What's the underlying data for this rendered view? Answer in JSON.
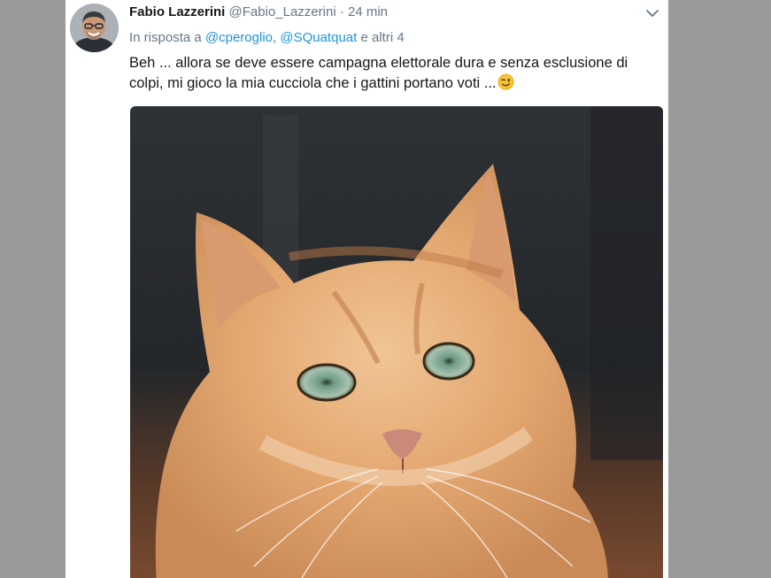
{
  "tweet": {
    "author_name": "Fabio Lazzerini",
    "author_handle": "@Fabio_Lazzerini",
    "separator": "·",
    "time": "24 min",
    "reply_prefix": "In risposta a",
    "reply_mention_1": "@cperoglio",
    "reply_comma": ",",
    "reply_mention_2": "@SQuatquat",
    "reply_suffix": "e altri 4",
    "text_line_1": "Beh ... allora se deve essere campagna elettorale dura e senza esclusione di",
    "text_line_2": "colpi, mi gioco la mia cucciola che i gattini portano voti ...",
    "emoji": "winking-face-icon",
    "media": "photo of an orange long-haired cat with green eyes"
  },
  "colors": {
    "link": "#1b95e0",
    "secondary_text": "#657786",
    "primary_text": "#14171a",
    "backdrop": "#9a9a9a"
  }
}
